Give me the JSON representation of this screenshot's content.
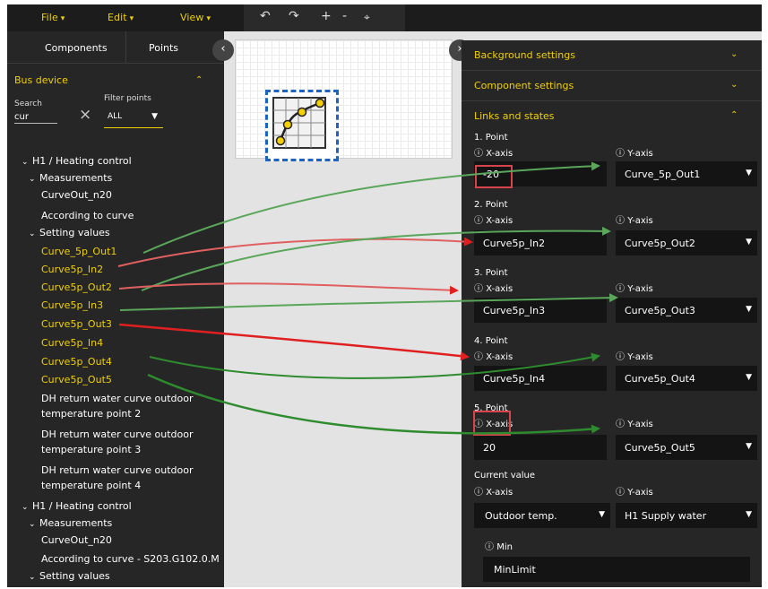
{
  "menu": {
    "file": "File",
    "edit": "Edit",
    "view": "View"
  },
  "toolbar": {
    "undo_icon": "undo-icon",
    "redo_icon": "redo-icon",
    "zoom_in": "+",
    "zoom_out": "-",
    "fit_icon": "fit-icon"
  },
  "left_panel": {
    "tabs": [
      "Components",
      "Points"
    ],
    "bus_device": "Bus device",
    "search_label": "Search",
    "search_value": "cur",
    "filter_label": "Filter points",
    "filter_value": "ALL",
    "tree": [
      "H1 / Heating control",
      "Measurements",
      "CurveOut_n20",
      "According to curve",
      "Setting values",
      "Curve_5p_Out1",
      "Curve5p_In2",
      "Curve5p_Out2",
      "Curve5p_In3",
      "Curve5p_Out3",
      "Curve5p_In4",
      "Curve5p_Out4",
      "Curve5p_Out5",
      "DH return water curve outdoor",
      "temperature point 2",
      "DH return water curve outdoor",
      "temperature point 3",
      "DH return water curve outdoor",
      "temperature point 4",
      "H1 / Heating control",
      "Measurements",
      "CurveOut_n20",
      "According to curve - S203.G102.0.M",
      "Setting values"
    ]
  },
  "right_panel": {
    "sections": [
      "Background settings",
      "Component settings",
      "Links and states"
    ],
    "points": [
      {
        "label": "1. Point",
        "x_label": "X-axis",
        "y_label": "Y-axis",
        "x_value": "-20",
        "y_value": "Curve_5p_Out1"
      },
      {
        "label": "2. Point",
        "x_label": "X-axis",
        "y_label": "Y-axis",
        "x_value": "Curve5p_In2",
        "y_value": "Curve5p_Out2"
      },
      {
        "label": "3. Point",
        "x_label": "X-axis",
        "y_label": "Y-axis",
        "x_value": "Curve5p_In3",
        "y_value": "Curve5p_Out3"
      },
      {
        "label": "4. Point",
        "x_label": "X-axis",
        "y_label": "Y-axis",
        "x_value": "Curve5p_In4",
        "y_value": "Curve5p_Out4"
      },
      {
        "label": "5. Point",
        "x_label": "X-axis",
        "y_label": "Y-axis",
        "x_value": "20",
        "y_value": "Curve5p_Out5"
      }
    ],
    "current_value": {
      "label": "Current value",
      "x_label": "X-axis",
      "y_label": "Y-axis",
      "x_value": "Outdoor temp.",
      "y_value": "H1 Supply water",
      "min_label": "Min",
      "min_value": "MinLimit"
    }
  },
  "colors": {
    "accent": "#f0d000",
    "panel": "#262626",
    "field": "#141414",
    "green_arrow": "#2e8b2e",
    "red_arrow": "#e02020",
    "highlight": "#d9434b",
    "selection": "#1e63c0"
  }
}
